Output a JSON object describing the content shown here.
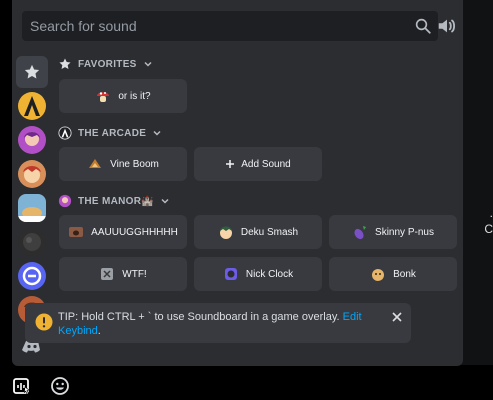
{
  "search": {
    "placeholder": "Search for sound"
  },
  "categories": {
    "favorites": "FAVORITES",
    "arcade": "THE ARCADE",
    "manor": "THE MANOR🏰"
  },
  "sounds": {
    "favorites": [
      "or is it?"
    ],
    "arcade": [
      "Vine Boom"
    ],
    "add_sound": "Add Sound",
    "manor": [
      "AAUUUGGHHHHH",
      "Deku Smash",
      "Skinny P-nus",
      "WTF!",
      "Nick Clock",
      "Bonk"
    ]
  },
  "tip": {
    "text": "TIP: Hold CTRL + ` to use Soundboard in a game overlay. ",
    "link": "Edit Keybind",
    "end": "."
  },
  "background_fragment": "C"
}
